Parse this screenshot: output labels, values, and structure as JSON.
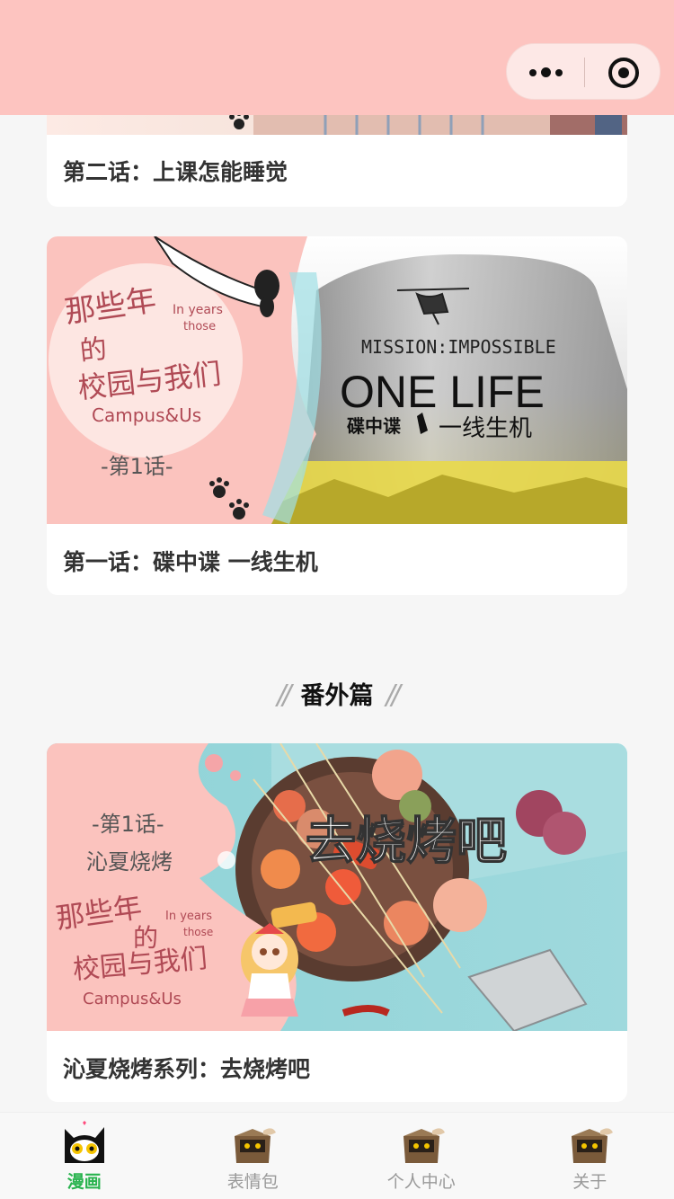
{
  "nav": {
    "more_icon": "more-dots-icon",
    "close_icon": "target-close-icon",
    "bg": "#fdc4c0"
  },
  "cards": [
    {
      "caption": "第二话：上课怎能睡觉"
    },
    {
      "caption": "第一话：碟中谍 一线生机",
      "cover": {
        "title_cn": "那些年的校园与我们",
        "title_en_a": "In years those",
        "title_en_b": "Campus&Us",
        "episode": "-第1话-",
        "movie_top": "MISSION:IMPOSSIBLE",
        "movie_main": "ONE LIFE",
        "movie_cn_left": "碟中谍",
        "movie_cn_right": "一线生机"
      }
    }
  ],
  "section_title": "番外篇",
  "special_card": {
    "caption": "沁夏烧烤系列：去烧烤吧",
    "cover": {
      "episode": "-第1话-",
      "subtitle": "沁夏烧烤",
      "big_title": "去烧烤吧",
      "title_cn": "那些年的校园与我们",
      "title_en_a": "In years those",
      "title_en_b": "Campus&Us"
    }
  },
  "tabs": [
    {
      "label": "漫画",
      "icon": "cat-icon",
      "active": true
    },
    {
      "label": "表情包",
      "icon": "box-cat-icon",
      "active": false
    },
    {
      "label": "个人中心",
      "icon": "box-cat-icon",
      "active": false
    },
    {
      "label": "关于",
      "icon": "box-cat-icon",
      "active": false
    }
  ],
  "colors": {
    "accent_green": "#28b34e",
    "pink": "#fdc4c0",
    "tab_inactive": "#999999"
  }
}
